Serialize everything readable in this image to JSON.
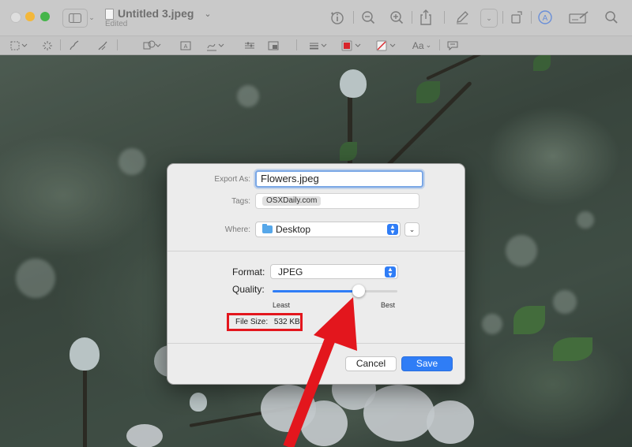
{
  "window": {
    "title": "Untitled 3.jpeg",
    "subtitle": "Edited"
  },
  "toolbar": {
    "icons": [
      "sidebar-icon",
      "info-icon",
      "zoom-out-icon",
      "zoom-in-icon",
      "share-icon",
      "markup-pen-icon",
      "rotate-icon",
      "markup-circle-icon",
      "signature-icon",
      "search-icon"
    ],
    "markup_icons": [
      "rect-select-icon",
      "instant-alpha-icon",
      "sketch-icon",
      "draw-icon",
      "shapes-icon",
      "text-box-icon",
      "sign-icon",
      "adjust-color-icon",
      "adjust-size-icon",
      "line-style-icon",
      "border-color-icon",
      "fill-color-icon",
      "text-style-icon",
      "note-icon"
    ],
    "text_style_label": "Aa"
  },
  "dialog": {
    "export_as_label": "Export As:",
    "export_as_value": "Flowers.jpeg",
    "tags_label": "Tags:",
    "tag": "OSXDaily.com",
    "where_label": "Where:",
    "where_value": "Desktop",
    "format_label": "Format:",
    "format_value": "JPEG",
    "quality_label": "Quality:",
    "quality_level": 0.69,
    "least_label": "Least",
    "best_label": "Best",
    "file_size_label": "File Size:",
    "file_size_value": "532 KB",
    "cancel_label": "Cancel",
    "save_label": "Save"
  },
  "colors": {
    "accent": "#2f7df6",
    "highlight": "#e3161d"
  }
}
